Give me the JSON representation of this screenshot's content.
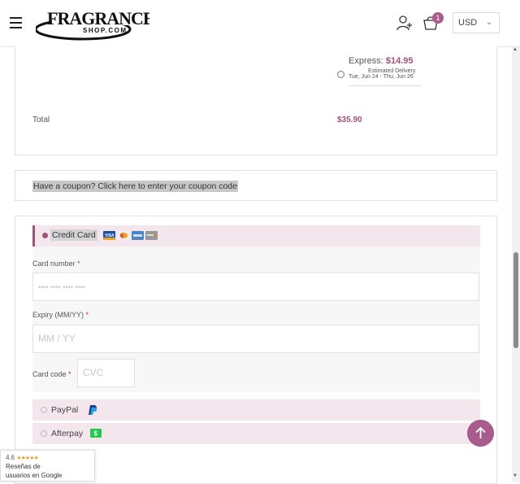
{
  "header": {
    "logo_line1": "FRAGRANCE",
    "logo_line2": "SHOP.COM",
    "cart_count": "1",
    "currency": "USD"
  },
  "shipping": {
    "express_label": "Express:",
    "express_price": "$14.95",
    "estimated_delivery_title": "Estimated Delivery",
    "estimated_delivery_dates": "Tue, Jun 24 - Thu, Jun 26"
  },
  "order": {
    "total_label": "Total",
    "total_value": "$35.90"
  },
  "coupon": {
    "text": "Have a coupon? Click here to enter your coupon code"
  },
  "payment": {
    "credit_card_label": "Credit Card",
    "card_logos": [
      "visa",
      "mastercard",
      "amex",
      "discover"
    ],
    "card_number_label": "Card number",
    "card_number_placeholder": "•••• •••• •••• ••••",
    "expiry_label": "Expiry (MM/YY)",
    "expiry_placeholder": "MM / YY",
    "card_code_label": "Card code",
    "card_code_placeholder": "CVC",
    "required_mark": "*",
    "paypal_label": "PayPal",
    "afterpay_label": "Afterpay"
  },
  "google_reviews": {
    "rating": "4.6",
    "stars": "★★★★★",
    "line1": "Reseñas de",
    "line2": "usuarios en Google"
  },
  "colors": {
    "accent": "#a0527d",
    "badge": "#a85b8c",
    "method_bg": "#f3e6ec"
  }
}
